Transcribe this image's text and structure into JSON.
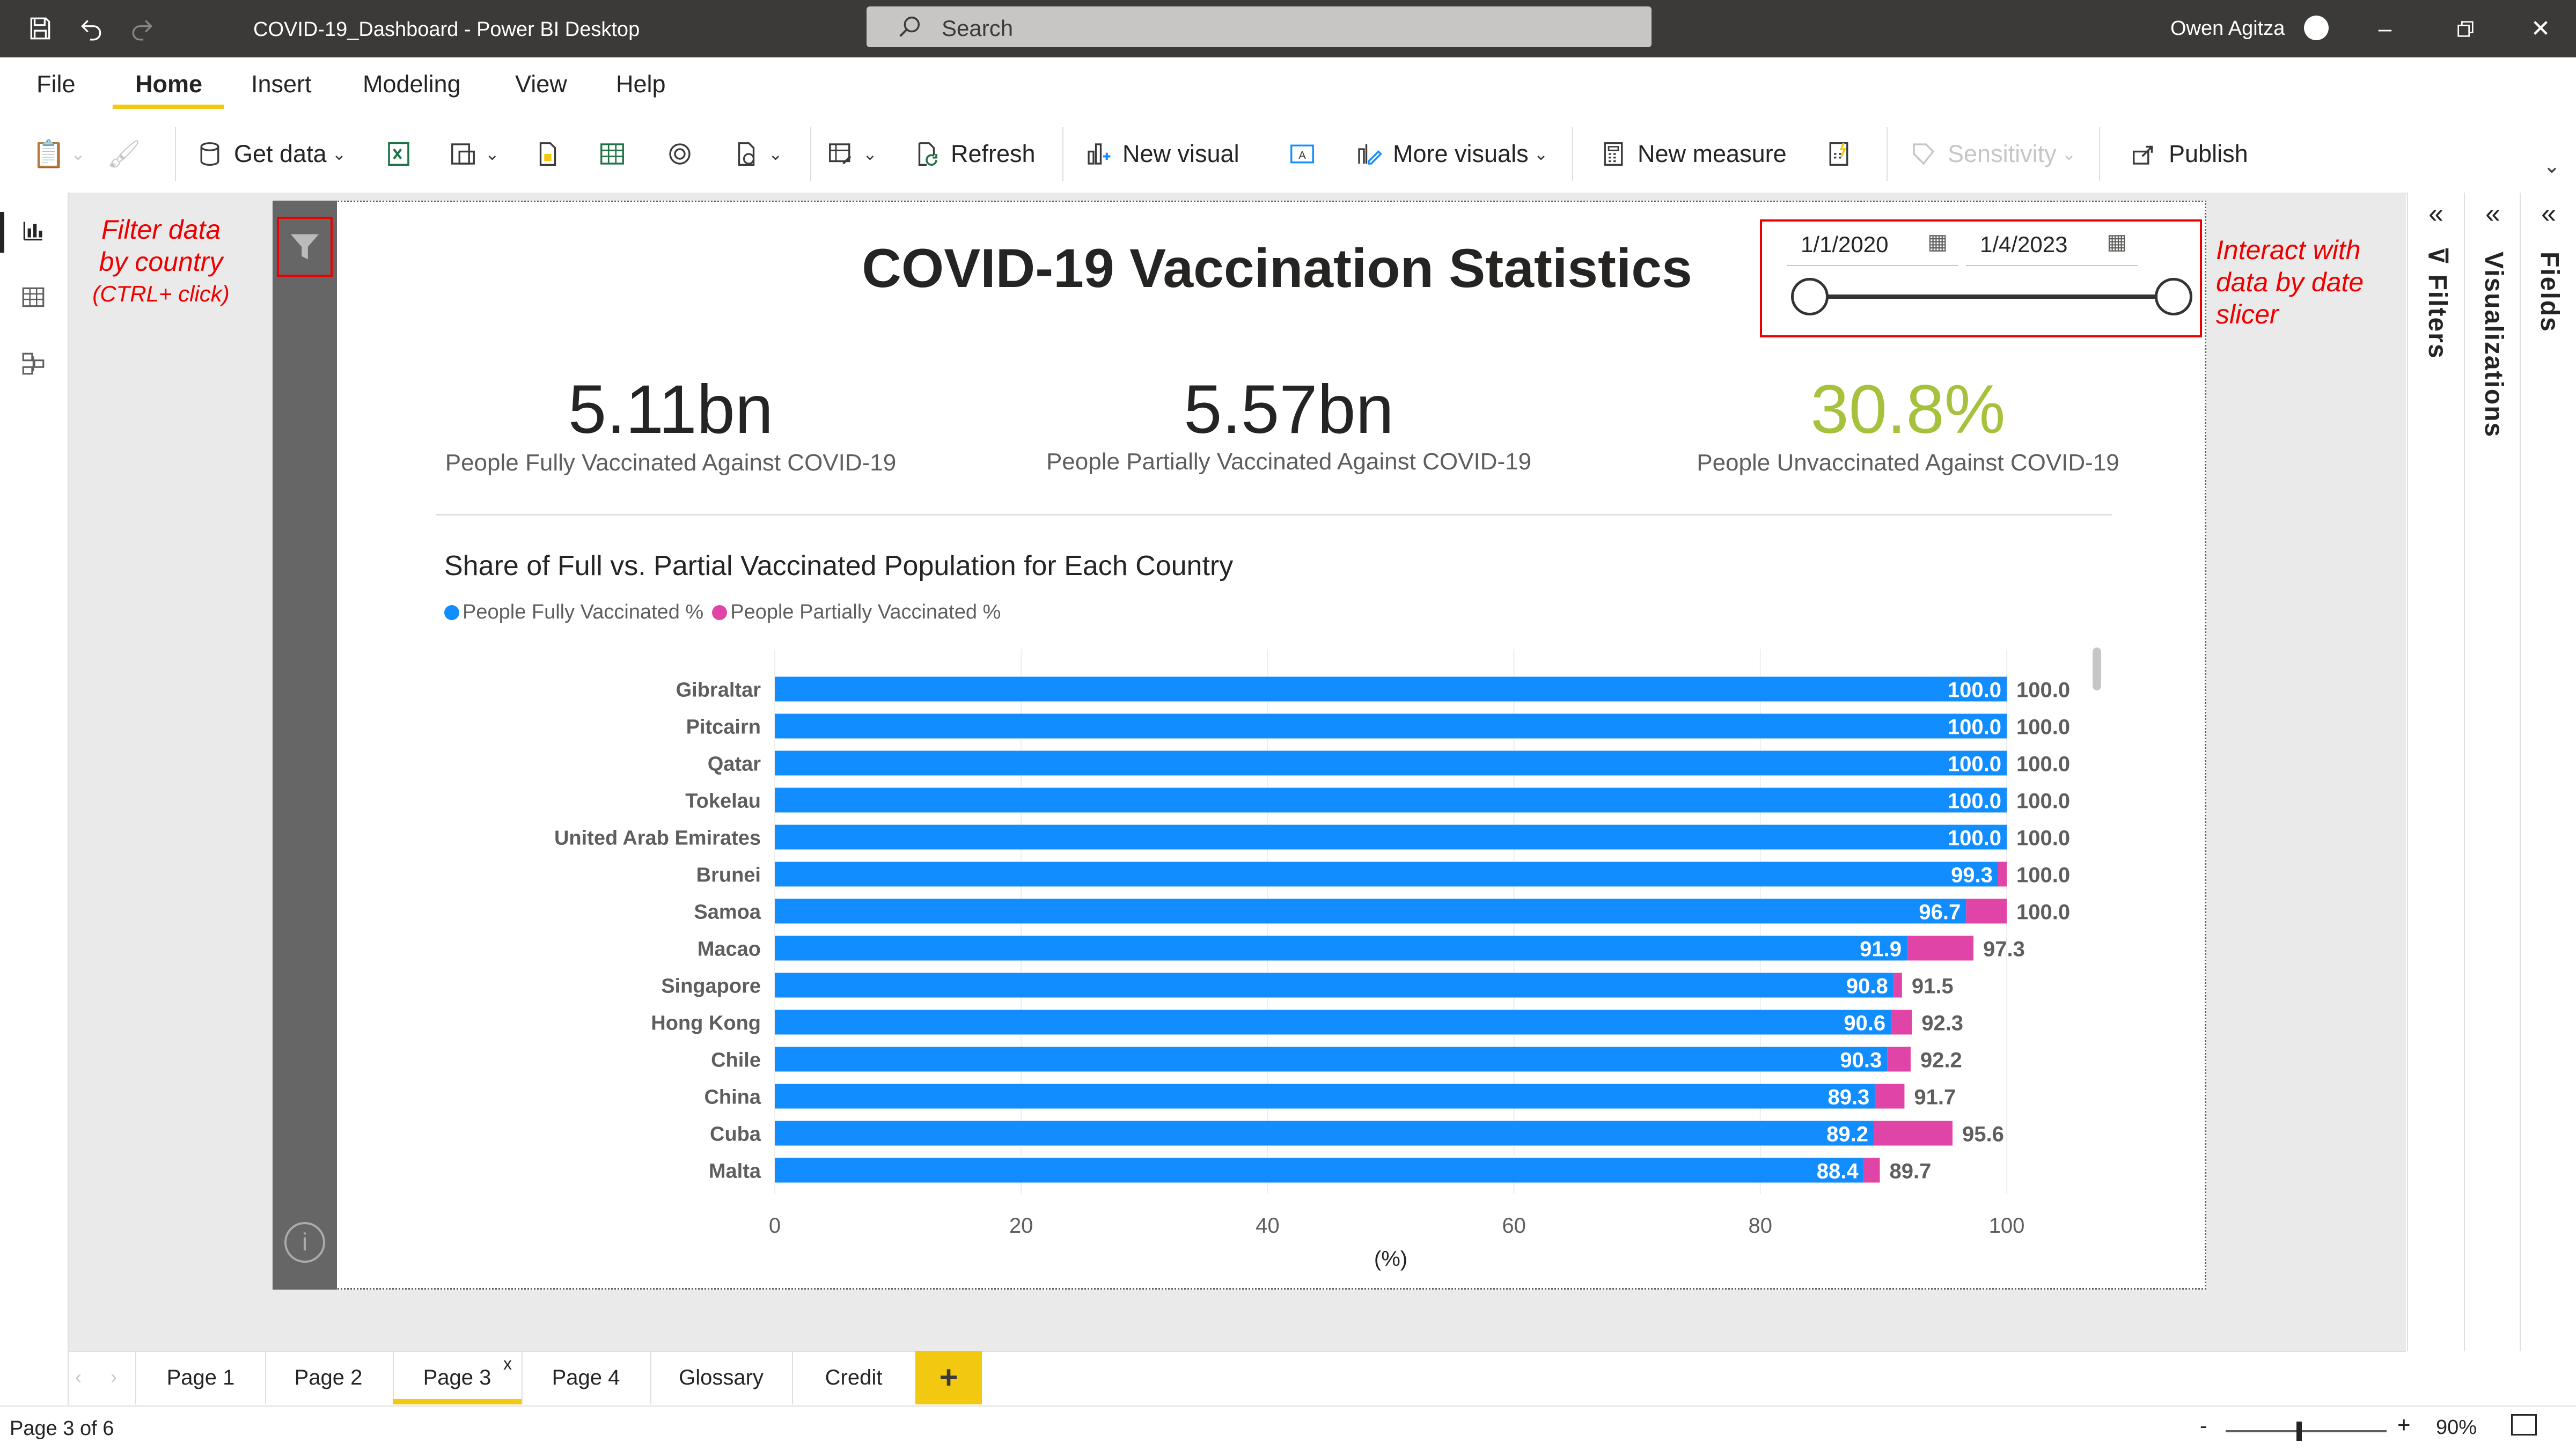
{
  "window": {
    "title": "COVID-19_Dashboard - Power BI Desktop",
    "search_placeholder": "Search",
    "user_name": "Owen Agitza"
  },
  "menu": {
    "file": "File",
    "home": "Home",
    "insert": "Insert",
    "modeling": "Modeling",
    "view": "View",
    "help": "Help"
  },
  "ribbon": {
    "get_data": "Get data",
    "refresh": "Refresh",
    "new_visual": "New visual",
    "more_visuals": "More visuals",
    "new_measure": "New measure",
    "sensitivity": "Sensitivity",
    "publish": "Publish"
  },
  "annotations": {
    "filter_line1": "Filter data",
    "filter_line2": "by country",
    "filter_line3": "(CTRL+ click)",
    "slicer_line1": "Interact with",
    "slicer_line2": "data by date",
    "slicer_line3": "slicer"
  },
  "report": {
    "title": "COVID-19 Vaccination Statistics",
    "date_start": "1/1/2020",
    "date_end": "1/4/2023",
    "kpis": [
      {
        "value": "5.11bn",
        "label": "People Fully Vaccinated Against COVID-19",
        "color": "#252423"
      },
      {
        "value": "5.57bn",
        "label": "People Partially Vaccinated Against COVID-19",
        "color": "#252423"
      },
      {
        "value": "30.8%",
        "label": "People Unvaccinated Against COVID-19",
        "color": "#a6c13b"
      }
    ]
  },
  "chart_data": {
    "type": "bar",
    "orientation": "horizontal",
    "stacked": true,
    "title": "Share of Full vs. Partial Vaccinated Population for Each Country",
    "xlabel": "(%)",
    "xlim": [
      0,
      100
    ],
    "xticks": [
      0,
      20,
      40,
      60,
      80,
      100
    ],
    "grid": true,
    "legend_position": "top-left",
    "categories": [
      "Gibraltar",
      "Pitcairn",
      "Qatar",
      "Tokelau",
      "United Arab Emirates",
      "Brunei",
      "Samoa",
      "Macao",
      "Singapore",
      "Hong Kong",
      "Chile",
      "China",
      "Cuba",
      "Malta"
    ],
    "series": [
      {
        "name": "People Fully Vaccinated %",
        "color": "#118dff",
        "values": [
          100.0,
          100.0,
          100.0,
          100.0,
          100.0,
          99.3,
          96.7,
          91.9,
          90.8,
          90.6,
          90.3,
          89.3,
          89.2,
          88.4
        ]
      },
      {
        "name": "People Partially Vaccinated %",
        "color": "#e044a7",
        "values": [
          100.0,
          100.0,
          100.0,
          100.0,
          100.0,
          100.0,
          100.0,
          97.3,
          91.5,
          92.3,
          92.2,
          91.7,
          95.6,
          89.7
        ]
      }
    ]
  },
  "pages": {
    "tabs": [
      "Page 1",
      "Page 2",
      "Page 3",
      "Page 4",
      "Glossary",
      "Credit"
    ],
    "active": "Page 3",
    "add_label": "+",
    "close_label": "x"
  },
  "panes": {
    "filters": "Filters",
    "visualizations": "Visualizations",
    "fields": "Fields"
  },
  "status": {
    "page_indicator": "Page 3 of 6",
    "zoom": "90%"
  }
}
